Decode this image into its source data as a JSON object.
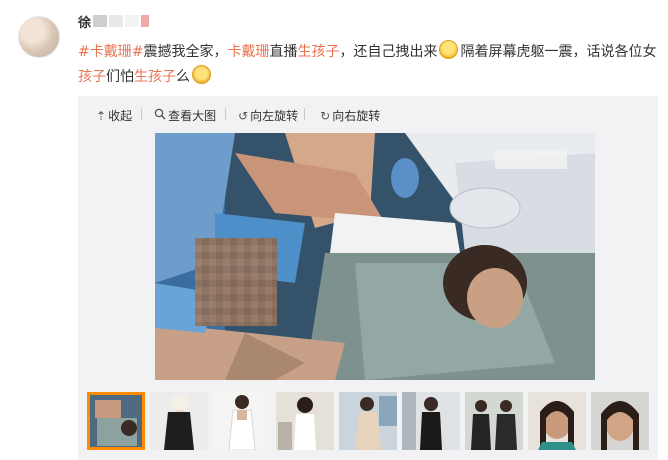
{
  "post": {
    "author_name": "徐",
    "text_parts": {
      "topic": "#卡戴珊#",
      "t1": "震撼我全家，",
      "hl1": "卡戴珊",
      "t2": "直播",
      "hl2": "生孩子",
      "t3": "，还自己拽出来",
      "t4": "隔着屏幕虎躯一震，话说各位女",
      "hl3": "孩子",
      "t5": "们怕",
      "hl4": "生孩子",
      "t6": "么"
    },
    "emoji_1": "shocked-emoji",
    "emoji_2": "laughing-emoji"
  },
  "toolbar": {
    "collapse": "收起",
    "view_large": "查看大图",
    "rotate_left": "向左旋转",
    "rotate_right": "向右旋转",
    "icons": {
      "collapse": "arrow-up-icon",
      "view_large": "magnifier-icon",
      "rotate_left": "rotate-left-icon",
      "rotate_right": "rotate-right-icon"
    }
  },
  "thumbnails": {
    "count": 9,
    "selected_index": 0
  },
  "colors": {
    "accent": "#eb7350",
    "selected_border": "#ff8c00",
    "panel_bg": "#f2f2f5"
  }
}
